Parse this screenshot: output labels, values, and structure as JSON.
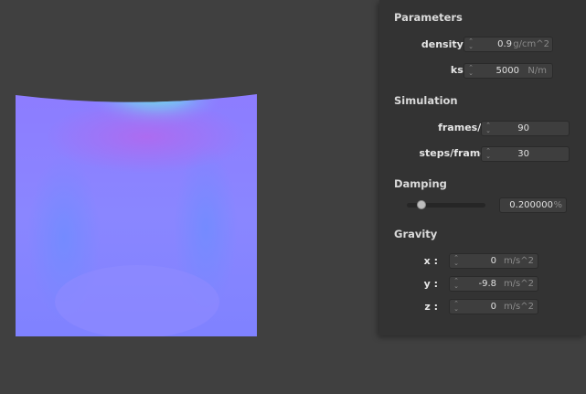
{
  "panel": {
    "parameters": {
      "title": "Parameters",
      "density": {
        "label": "density :",
        "value": "0.9",
        "unit": "g/cm^2"
      },
      "ks": {
        "label": "ks :",
        "value": "5000",
        "unit": "N/m"
      }
    },
    "simulation": {
      "title": "Simulation",
      "fps": {
        "label": "frames/s :",
        "value": "90"
      },
      "steps": {
        "label": "steps/frame :",
        "value": "30"
      }
    },
    "damping": {
      "title": "Damping",
      "value": "0.200000",
      "unit": "%",
      "slider_level": 0.2
    },
    "gravity": {
      "title": "Gravity",
      "x": {
        "label": "x :",
        "value": "0",
        "unit": "m/s^2"
      },
      "y": {
        "label": "y :",
        "value": "-9.8",
        "unit": "m/s^2"
      },
      "z": {
        "label": "z :",
        "value": "0",
        "unit": "m/s^2"
      }
    }
  },
  "colors": {
    "background": "#404040",
    "panel": "#333333",
    "cloth_base": "#8a84ff",
    "cloth_highlight": "#6fd8e8",
    "cloth_fold": "#a070ee"
  },
  "icons": {
    "spinner": "up-down-arrows-icon"
  }
}
